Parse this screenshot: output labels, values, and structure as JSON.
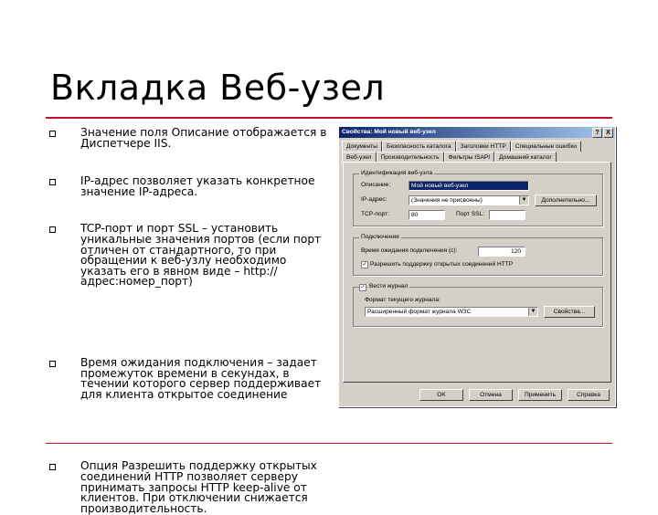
{
  "slide": {
    "title": "Вкладка Веб-узел",
    "bullets": [
      "Значение поля Описание отображается в Диспетчере IIS.",
      "IP-адрес позволяет указать конкретное значение IP-адреса.",
      "TCP-порт и порт SSL – установить уникальные значения портов (если порт отличен от стандартного, то при обращении к веб-узлу необходимо указать его в явном виде – http://адрес:номер_порт)",
      "Время ожидания подключения – задает промежуток времени в секундах, в течении которого сервер поддерживает для клиента открытое соединение",
      "Опция Разрешить поддержку открытых соединений HTTP позволяет серверу принимать запросы HTTP keep-alive от клиентов. При отключении снижается производительность."
    ]
  },
  "dialog": {
    "title": "Свойства: Мой новый веб-узел",
    "help_btn": "?",
    "close_btn": "X",
    "tabs_row1": [
      "Документы",
      "Безопасность каталога",
      "Заголовки HTTP",
      "Специальные ошибки"
    ],
    "tabs_row2": [
      "Веб-узел",
      "Производительность",
      "Фильтры ISAPI",
      "Домашний каталог"
    ],
    "identification": {
      "group_title": "Идентификация веб-узла",
      "description_label": "Описание:",
      "description_value": "Мой новый веб-узел",
      "ip_label": "IP-адрес:",
      "ip_value": "(Значения не присвоены)",
      "advanced_btn": "Дополнительно...",
      "tcp_label": "TCP-порт:",
      "tcp_value": "80",
      "ssl_label": "Порт SSL:",
      "ssl_value": ""
    },
    "connections": {
      "group_title": "Подключения",
      "timeout_label": "Время ожидания подключения (с):",
      "timeout_value": "120",
      "keepalive_label": "Разрешить поддержку открытых соединений HTTP",
      "keepalive_checked": true
    },
    "logging": {
      "enable_label": "Вести журнал",
      "enable_checked": true,
      "format_label": "Формат текущего журнала:",
      "format_value": "Расширенный формат журнала W3C",
      "properties_btn": "Свойства..."
    },
    "buttons": {
      "ok": "OK",
      "cancel": "Отмена",
      "apply": "Применить",
      "help": "Справка"
    }
  }
}
